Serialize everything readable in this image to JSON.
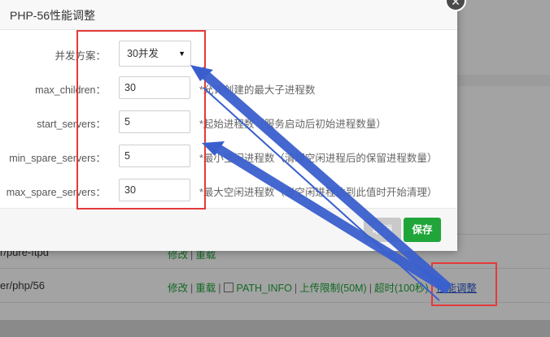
{
  "background": {
    "rows": [
      {
        "name": "r/pure-ftpd",
        "ops": [
          "修改",
          "重载"
        ]
      },
      {
        "name": "er/php/56",
        "ops": [
          "修改",
          "重载"
        ],
        "path_info": "PATH_INFO",
        "upload_limit": "上传限制(50M)",
        "timeout": "超时(100秒)",
        "perf": "性能调整"
      }
    ]
  },
  "dialog": {
    "title": "PHP-56性能调整",
    "close_icon": "×",
    "concurrency": {
      "label": "并发方案：",
      "selected": "30并发",
      "caret": "▼"
    },
    "fields": [
      {
        "label": "max_children：",
        "value": "30",
        "hint": "*允许创建的最大子进程数"
      },
      {
        "label": "start_servers：",
        "value": "5",
        "hint": "*起始进程数（服务启动后初始进程数量）"
      },
      {
        "label": "min_spare_servers：",
        "value": "5",
        "hint": "*最小空闲进程数（清理空闲进程后的保留进程数量）"
      },
      {
        "label": "max_spare_servers：",
        "value": "30",
        "hint": "*最大空闲进程数（当空闲进程达到此值时开始清理）"
      }
    ],
    "buttons": {
      "cancel": "取消",
      "save": "保存"
    }
  },
  "annotation_colors": {
    "highlight": "#e43a3a",
    "arrow": "#3a5fcd",
    "save": "#20a53a"
  }
}
